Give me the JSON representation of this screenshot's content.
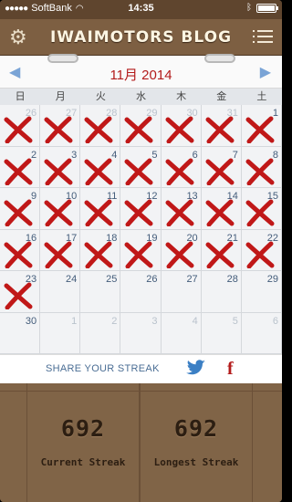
{
  "status_bar": {
    "carrier": "SoftBank",
    "time": "14:35"
  },
  "nav": {
    "title": "IWAIMOTORS BLOG",
    "left_icon": "gear-icon",
    "right_icon": "menu-icon"
  },
  "calendar": {
    "month_label": "11月 2014",
    "weekdays": [
      "日",
      "月",
      "火",
      "水",
      "木",
      "金",
      "土"
    ],
    "weeks": [
      [
        {
          "d": "26",
          "other": true,
          "x": true
        },
        {
          "d": "27",
          "other": true,
          "x": true
        },
        {
          "d": "28",
          "other": true,
          "x": true
        },
        {
          "d": "29",
          "other": true,
          "x": true
        },
        {
          "d": "30",
          "other": true,
          "x": true
        },
        {
          "d": "31",
          "other": true,
          "x": true
        },
        {
          "d": "1",
          "other": false,
          "x": true
        }
      ],
      [
        {
          "d": "2",
          "other": false,
          "x": true
        },
        {
          "d": "3",
          "other": false,
          "x": true
        },
        {
          "d": "4",
          "other": false,
          "x": true
        },
        {
          "d": "5",
          "other": false,
          "x": true
        },
        {
          "d": "6",
          "other": false,
          "x": true
        },
        {
          "d": "7",
          "other": false,
          "x": true
        },
        {
          "d": "8",
          "other": false,
          "x": true
        }
      ],
      [
        {
          "d": "9",
          "other": false,
          "x": true
        },
        {
          "d": "10",
          "other": false,
          "x": true
        },
        {
          "d": "11",
          "other": false,
          "x": true
        },
        {
          "d": "12",
          "other": false,
          "x": true
        },
        {
          "d": "13",
          "other": false,
          "x": true
        },
        {
          "d": "14",
          "other": false,
          "x": true
        },
        {
          "d": "15",
          "other": false,
          "x": true
        }
      ],
      [
        {
          "d": "16",
          "other": false,
          "x": true
        },
        {
          "d": "17",
          "other": false,
          "x": true
        },
        {
          "d": "18",
          "other": false,
          "x": true
        },
        {
          "d": "19",
          "other": false,
          "x": true
        },
        {
          "d": "20",
          "other": false,
          "x": true
        },
        {
          "d": "21",
          "other": false,
          "x": true
        },
        {
          "d": "22",
          "other": false,
          "x": true
        }
      ],
      [
        {
          "d": "23",
          "other": false,
          "x": true
        },
        {
          "d": "24",
          "other": false,
          "x": false
        },
        {
          "d": "25",
          "other": false,
          "x": false
        },
        {
          "d": "26",
          "other": false,
          "x": false
        },
        {
          "d": "27",
          "other": false,
          "x": false
        },
        {
          "d": "28",
          "other": false,
          "x": false
        },
        {
          "d": "29",
          "other": false,
          "x": false
        }
      ],
      [
        {
          "d": "30",
          "other": false,
          "x": false
        },
        {
          "d": "1",
          "other": true,
          "x": false
        },
        {
          "d": "2",
          "other": true,
          "x": false
        },
        {
          "d": "3",
          "other": true,
          "x": false
        },
        {
          "d": "4",
          "other": true,
          "x": false
        },
        {
          "d": "5",
          "other": true,
          "x": false
        },
        {
          "d": "6",
          "other": true,
          "x": false
        }
      ]
    ]
  },
  "share": {
    "label": "SHARE YOUR STREAK",
    "twitter_icon": "twitter-icon",
    "facebook_icon": "facebook-icon"
  },
  "stats": {
    "current": {
      "value": "692",
      "label": "Current Streak"
    },
    "longest": {
      "value": "692",
      "label": "Longest Streak"
    }
  },
  "colors": {
    "mark": "#c01818",
    "accent": "#b31b1b",
    "wood": "#7d5f42"
  }
}
